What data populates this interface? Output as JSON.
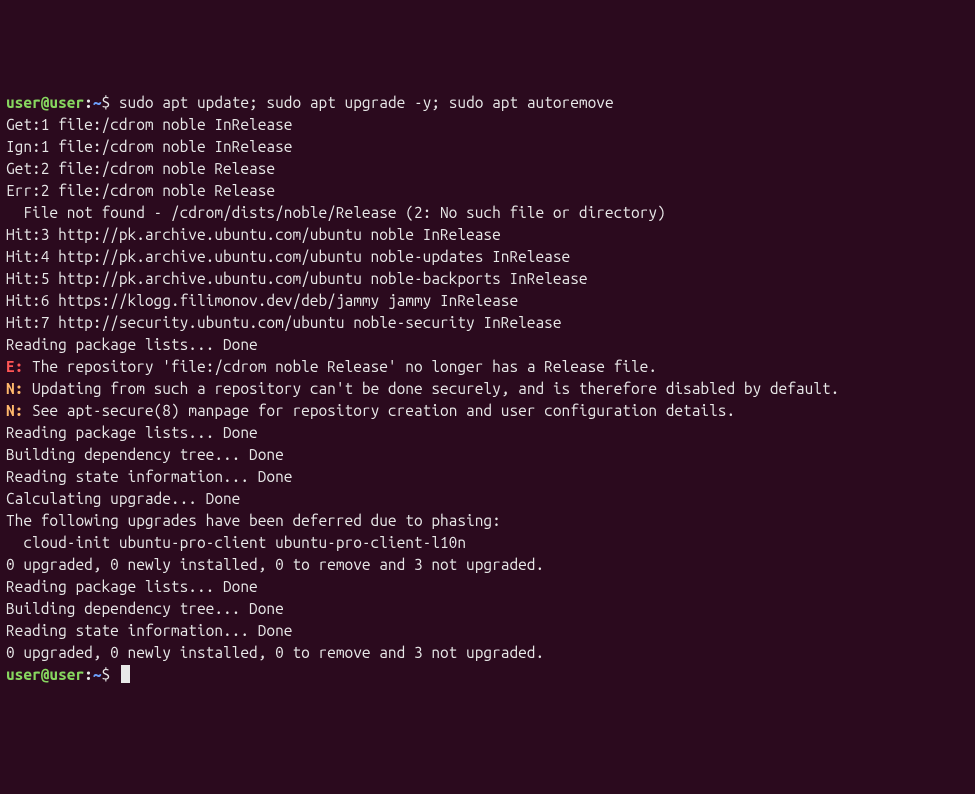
{
  "prompt": {
    "user_host": "user@user",
    "colon": ":",
    "path": "~",
    "symbol": "$"
  },
  "command": "sudo apt update; sudo apt upgrade -y; sudo apt autoremove",
  "lines": [
    {
      "type": "plain",
      "text": "Get:1 file:/cdrom noble InRelease"
    },
    {
      "type": "plain",
      "text": "Ign:1 file:/cdrom noble InRelease"
    },
    {
      "type": "plain",
      "text": "Get:2 file:/cdrom noble Release"
    },
    {
      "type": "plain",
      "text": "Err:2 file:/cdrom noble Release"
    },
    {
      "type": "plain",
      "text": "  File not found - /cdrom/dists/noble/Release (2: No such file or directory)"
    },
    {
      "type": "plain",
      "text": "Hit:3 http://pk.archive.ubuntu.com/ubuntu noble InRelease"
    },
    {
      "type": "plain",
      "text": "Hit:4 http://pk.archive.ubuntu.com/ubuntu noble-updates InRelease"
    },
    {
      "type": "plain",
      "text": "Hit:5 http://pk.archive.ubuntu.com/ubuntu noble-backports InRelease"
    },
    {
      "type": "plain",
      "text": "Hit:6 https://klogg.filimonov.dev/deb/jammy jammy InRelease"
    },
    {
      "type": "plain",
      "text": "Hit:7 http://security.ubuntu.com/ubuntu noble-security InRelease"
    },
    {
      "type": "plain",
      "text": "Reading package lists... Done"
    },
    {
      "type": "error",
      "tag": "E:",
      "text": " The repository 'file:/cdrom noble Release' no longer has a Release file."
    },
    {
      "type": "notice",
      "tag": "N:",
      "text": " Updating from such a repository can't be done securely, and is therefore disabled by default."
    },
    {
      "type": "notice",
      "tag": "N:",
      "text": " See apt-secure(8) manpage for repository creation and user configuration details."
    },
    {
      "type": "plain",
      "text": "Reading package lists... Done"
    },
    {
      "type": "plain",
      "text": "Building dependency tree... Done"
    },
    {
      "type": "plain",
      "text": "Reading state information... Done"
    },
    {
      "type": "plain",
      "text": "Calculating upgrade... Done"
    },
    {
      "type": "plain",
      "text": "The following upgrades have been deferred due to phasing:"
    },
    {
      "type": "plain",
      "text": "  cloud-init ubuntu-pro-client ubuntu-pro-client-l10n"
    },
    {
      "type": "plain",
      "text": "0 upgraded, 0 newly installed, 0 to remove and 3 not upgraded."
    },
    {
      "type": "plain",
      "text": "Reading package lists... Done"
    },
    {
      "type": "plain",
      "text": "Building dependency tree... Done"
    },
    {
      "type": "plain",
      "text": "Reading state information... Done"
    },
    {
      "type": "plain",
      "text": "0 upgraded, 0 newly installed, 0 to remove and 3 not upgraded."
    }
  ]
}
